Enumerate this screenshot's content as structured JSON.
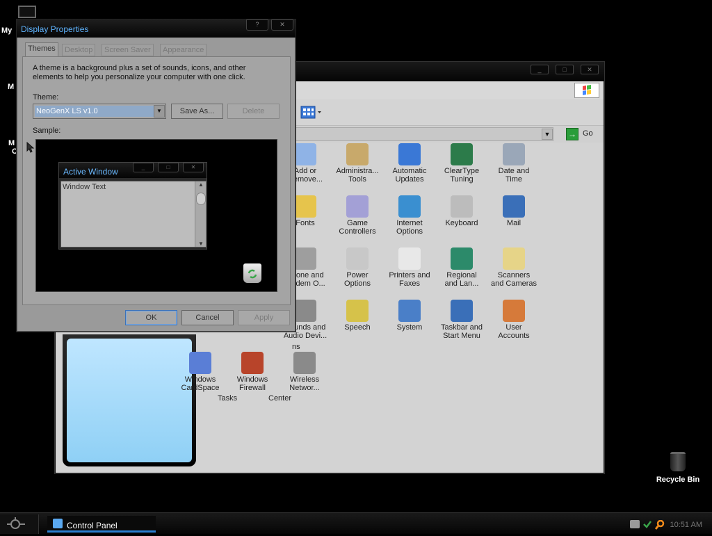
{
  "desktop": {
    "icon_labels": [
      "My",
      "M",
      "M",
      "C"
    ],
    "recycle_bin_label": "Recycle Bin"
  },
  "control_panel": {
    "window_controls": [
      "_",
      "□",
      "✕"
    ],
    "go_label": "Go",
    "partial_labels": [
      "e",
      "ns",
      "Tasks",
      "Center"
    ],
    "items": [
      {
        "label": "Add or\nRemove...",
        "icon": "cd-box-icon",
        "color": "#8fb3e6"
      },
      {
        "label": "Administra...\nTools",
        "icon": "tools-icon",
        "color": "#c8a96b"
      },
      {
        "label": "Automatic\nUpdates",
        "icon": "windows-flag-icon",
        "color": "#3a78d6"
      },
      {
        "label": "ClearType\nTuning",
        "icon": "cleartype-icon",
        "color": "#2c7b4a"
      },
      {
        "label": "Date and\nTime",
        "icon": "clock-icon",
        "color": "#9aa7b8"
      },
      {
        "label": "Fonts",
        "icon": "fonts-folder-icon",
        "color": "#e6c44c"
      },
      {
        "label": "Game\nControllers",
        "icon": "gamepad-icon",
        "color": "#a3a0d6"
      },
      {
        "label": "Internet\nOptions",
        "icon": "globe-check-icon",
        "color": "#3a8fd0"
      },
      {
        "label": "Keyboard",
        "icon": "keyboard-icon",
        "color": "#bcbcbc"
      },
      {
        "label": "Mail",
        "icon": "mail-icon",
        "color": "#3a6fb8"
      },
      {
        "label": "Phone and\nModem O...",
        "icon": "phone-icon",
        "color": "#9e9e9e"
      },
      {
        "label": "Power\nOptions",
        "icon": "power-plug-icon",
        "color": "#c8c8c8"
      },
      {
        "label": "Printers and\nFaxes",
        "icon": "printer-icon",
        "color": "#e8e8e8"
      },
      {
        "label": "Regional\nand Lan...",
        "icon": "globe-icon",
        "color": "#2c8a6a"
      },
      {
        "label": "Scanners\nand Cameras",
        "icon": "scanner-icon",
        "color": "#e6d488"
      },
      {
        "label": "Sounds and\nAudio Devi...",
        "icon": "speaker-icon",
        "color": "#8a8a8a"
      },
      {
        "label": "Speech",
        "icon": "speech-icon",
        "color": "#d6c24a"
      },
      {
        "label": "System",
        "icon": "system-icon",
        "color": "#4a7fc8"
      },
      {
        "label": "Taskbar and\nStart Menu",
        "icon": "taskbar-icon",
        "color": "#3a6fb8"
      },
      {
        "label": "User\nAccounts",
        "icon": "users-icon",
        "color": "#d67a3a"
      },
      {
        "label": "Windows\nCardSpace",
        "icon": "cardspace-icon",
        "color": "#5a7ed6"
      },
      {
        "label": "Windows\nFirewall",
        "icon": "firewall-icon",
        "color": "#b8442a"
      },
      {
        "label": "Wireless\nNetwor...",
        "icon": "wireless-icon",
        "color": "#8a8a8a"
      }
    ]
  },
  "display_properties": {
    "title": "Display Properties",
    "title_controls": [
      "?",
      "✕"
    ],
    "tabs": [
      "Themes",
      "Desktop",
      "Screen Saver",
      "Appearance"
    ],
    "description": "A theme is a background plus a set of sounds, icons, and other elements to help you personalize your computer with one click.",
    "theme_label": "Theme:",
    "theme_value": "NeoGenX LS v1.0",
    "save_as_label": "Save As...",
    "delete_label": "Delete",
    "sample_label": "Sample:",
    "sample": {
      "active_window_title": "Active Window",
      "window_text": "Window Text",
      "controls": [
        "_",
        "□",
        "✕"
      ]
    },
    "ok_label": "OK",
    "cancel_label": "Cancel",
    "apply_label": "Apply"
  },
  "taskbar": {
    "task_label": "Control Panel",
    "clock": "10:51 AM"
  }
}
